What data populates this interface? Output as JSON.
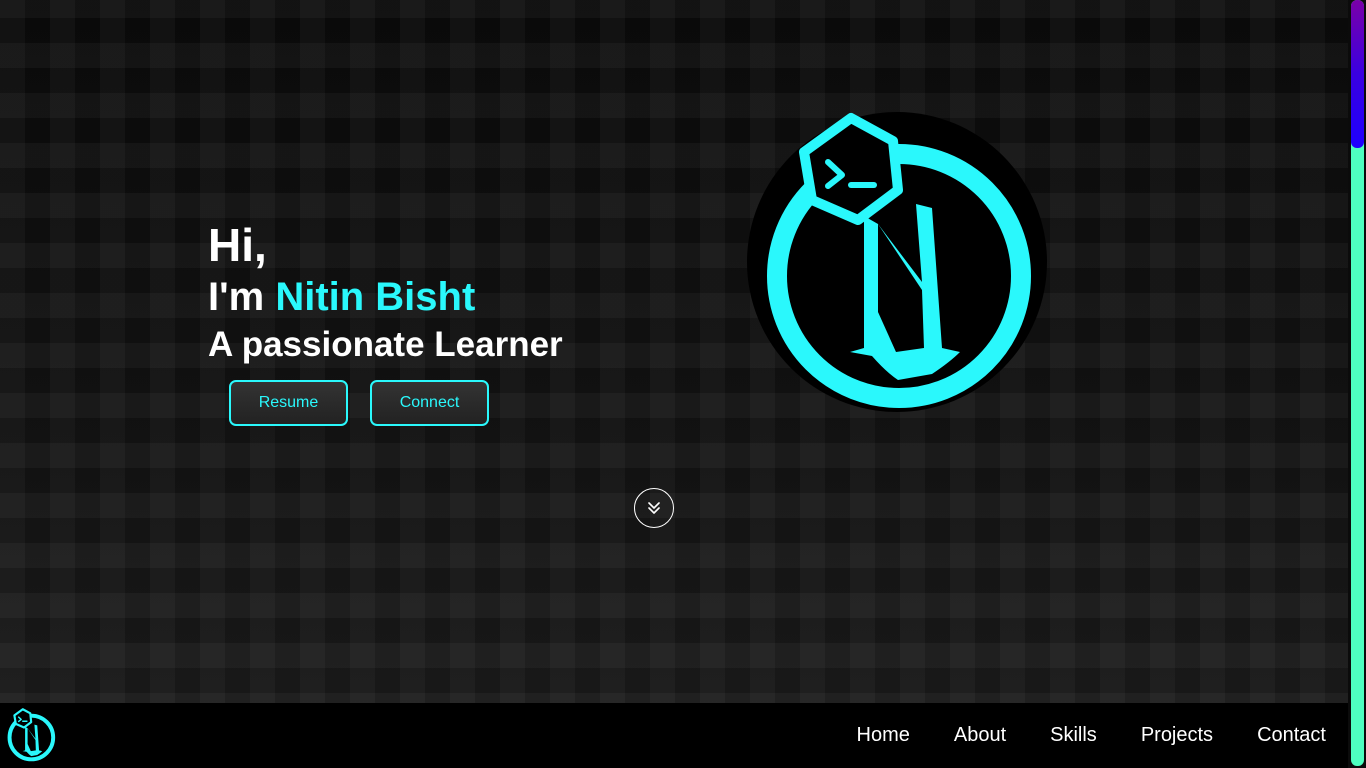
{
  "hero": {
    "greeting": "Hi,",
    "intro_prefix": "I'm ",
    "name": "Nitin Bisht",
    "tagline": "A passionate Learner",
    "buttons": {
      "resume": "Resume",
      "connect": "Connect"
    }
  },
  "icons": {
    "logo": "nitin-logo-icon",
    "scroll_down": "double-chevron-down-icon"
  },
  "nav": {
    "items": [
      "Home",
      "About",
      "Skills",
      "Projects",
      "Contact"
    ]
  },
  "colors": {
    "accent": "#2af8fc",
    "background": "#0d0d0d",
    "nav_background": "#000000",
    "text": "#ffffff",
    "scrollbar_track": "#4effc0",
    "scrollbar_thumb_top": "#7a00a8",
    "scrollbar_thumb_bottom": "#1e00ff"
  }
}
